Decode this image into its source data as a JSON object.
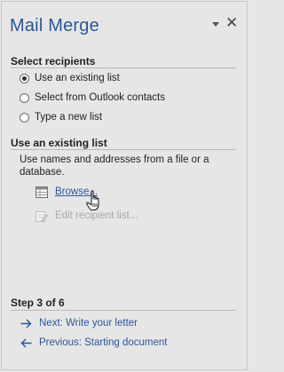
{
  "pane": {
    "title": "Mail Merge"
  },
  "select_recipients": {
    "heading": "Select recipients",
    "options": [
      {
        "label": "Use an existing list",
        "selected": true
      },
      {
        "label": "Select from Outlook contacts",
        "selected": false
      },
      {
        "label": "Type a new list",
        "selected": false
      }
    ]
  },
  "existing_list": {
    "heading": "Use an existing list",
    "description": "Use names and addresses from a file or a database.",
    "browse_label": "Browse...",
    "edit_label": "Edit recipient list..."
  },
  "footer": {
    "step": "Step 3 of 6",
    "next_label": "Next: Write your letter",
    "previous_label": "Previous: Starting document"
  },
  "colors": {
    "accent": "#2b579a",
    "background": "#e6e6e6",
    "disabled_text": "#a8a8a8"
  }
}
